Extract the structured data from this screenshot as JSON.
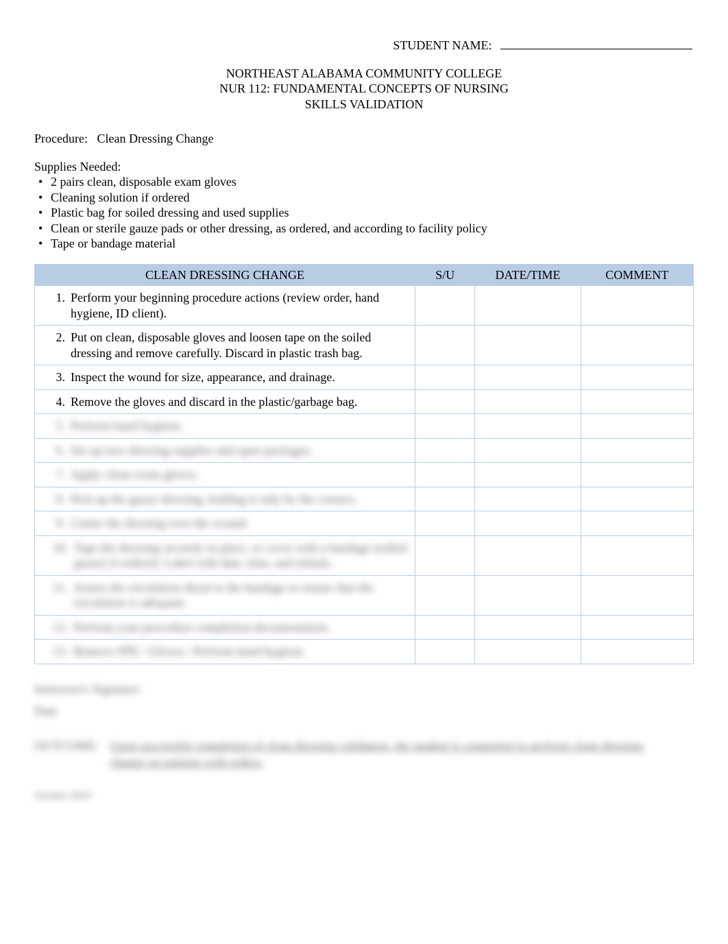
{
  "student_name_label": "STUDENT NAME:",
  "header": {
    "line1": "NORTHEAST ALABAMA COMMUNITY COLLEGE",
    "line2": "NUR 112:   FUNDAMENTAL CONCEPTS OF NURSING",
    "line3": "SKILLS VALIDATION"
  },
  "procedure_label": "Procedure:",
  "procedure_name": "Clean Dressing Change",
  "supplies_label": "Supplies Needed:",
  "supplies": [
    "2 pairs clean, disposable exam gloves",
    "Cleaning solution if ordered",
    "Plastic bag for soiled dressing and used supplies",
    "Clean or sterile gauze pads or other dressing, as ordered, and according to facility policy",
    "Tape or bandage material"
  ],
  "table": {
    "steps_header": "CLEAN DRESSING CHANGE",
    "su_header": "S/U",
    "datetime_header": "DATE/TIME",
    "comment_header": "COMMENT",
    "steps": [
      {
        "num": "1.",
        "text": "Perform your beginning procedure actions (review order, hand hygiene, ID client).",
        "blurred": false
      },
      {
        "num": "2.",
        "text": "Put on clean, disposable gloves and loosen tape on the soiled dressing and remove carefully.  Discard in plastic trash bag.",
        "blurred": false
      },
      {
        "num": "3.",
        "text": "Inspect the wound for size, appearance, and drainage.",
        "blurred": false
      },
      {
        "num": "4.",
        "text": "Remove the gloves and discard in the plastic/garbage bag.",
        "blurred": false
      },
      {
        "num": "5.",
        "text": "Perform hand hygiene.",
        "blurred": true
      },
      {
        "num": "6.",
        "text": "Set up new dressing supplies and open packages.",
        "blurred": true
      },
      {
        "num": "7.",
        "text": "Apply clean exam gloves.",
        "blurred": true
      },
      {
        "num": "8.",
        "text": "Pick up the gauze dressing, holding it only by the corners.",
        "blurred": true
      },
      {
        "num": "9.",
        "text": "Center the dressing over the wound.",
        "blurred": true
      },
      {
        "num": "10.",
        "text": "Tape the dressing securely in place, or cover with a bandage (rolled gauze) if ordered.  Label with date, time, and initials.",
        "blurred": true
      },
      {
        "num": "11.",
        "text": "Assess the circulation distal to the bandage to ensure that the circulation is adequate.",
        "blurred": true
      },
      {
        "num": "12.",
        "text": "Perform your procedure completion documentation.",
        "blurred": true
      },
      {
        "num": "13.",
        "text": "Remove PPE / Gloves / Perform hand hygiene.",
        "blurred": true
      }
    ]
  },
  "signature_label": "Instructor's Signature",
  "date_label": "Date",
  "outcome_label": "OUTCOME:",
  "outcome_text_line1": "Upon successful completion of clean dressing validation, the student is competent to perform clean dressing",
  "outcome_text_line2": "change on patients with orders.",
  "footer_date": "October 2019"
}
